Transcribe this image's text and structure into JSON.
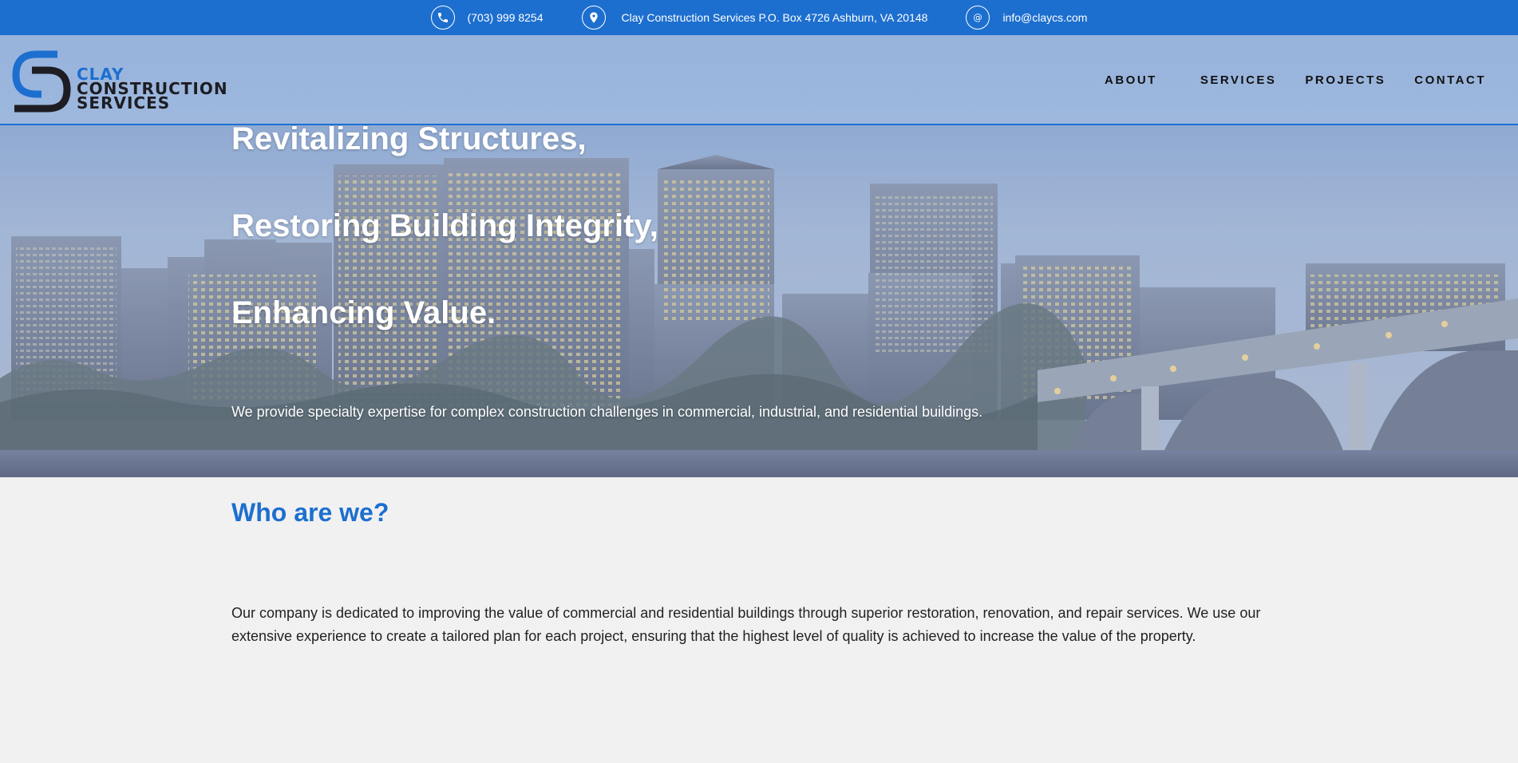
{
  "topbar": {
    "phone": "(703) 999 8254",
    "address": "Clay Construction Services P.O. Box 4726 Ashburn, VA 20148",
    "email": "info@claycs.com",
    "icons": [
      "phone-icon",
      "location-pin-icon",
      "at-sign-icon"
    ]
  },
  "logo": {
    "line1": "CLAY",
    "line2": "CONSTRUCTION",
    "line3": "SERVICES"
  },
  "nav": {
    "about": "ABOUT",
    "services": "SERVICES",
    "projects": "PROJECTS",
    "contact": "CONTACT"
  },
  "hero": {
    "line1": "Revitalizing Structures,",
    "line2": "Restoring Building Integrity,",
    "line3": "Enhancing Value.",
    "subtitle": "We provide specialty expertise for complex construction challenges in commercial, industrial, and residential buildings."
  },
  "about": {
    "title": "Who are we?",
    "body": "Our company is dedicated to improving the value of commercial and residential buildings through superior restoration, renovation, and repair services. We use our extensive experience to create a tailored plan for each project, ensuring that the highest level of quality is achieved to increase the value of the property."
  },
  "colors": {
    "brand_blue": "#1d6fcf",
    "dark": "#1d1d23",
    "background": "#f1f1f1"
  }
}
